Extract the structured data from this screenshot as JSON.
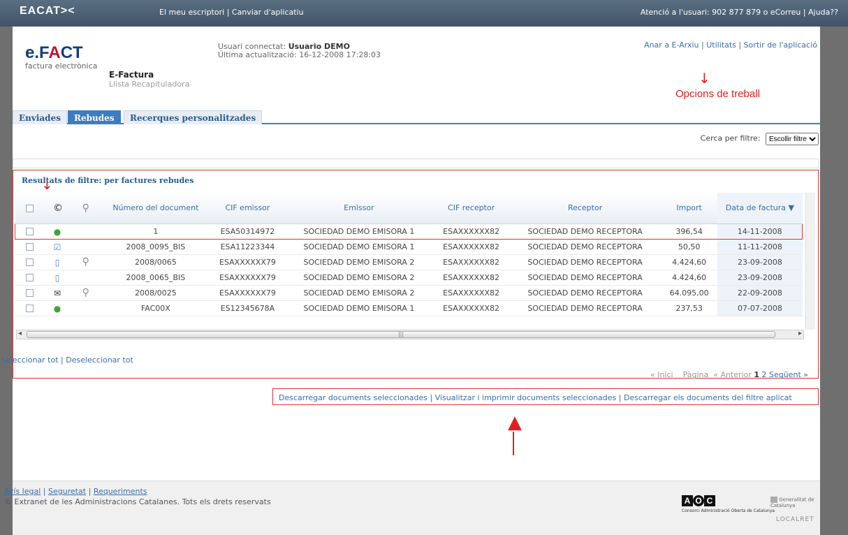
{
  "topbar": {
    "logo": "EACAT><",
    "links": [
      "El meu escriptori",
      "Canviar d'aplicatiu"
    ],
    "support": "Atenció a l'usuari: 902 877 879 o eCorreu | Ajuda??"
  },
  "brand": {
    "efact_pre": "e.F",
    "efact_a": "A",
    "efact_post": "CT",
    "subtitle": "factura electrònica"
  },
  "app": {
    "name": "E-Factura",
    "subtitle": "Llista Recapituladora"
  },
  "user": {
    "label": "Usuari connectat:",
    "name": "Usuario DEMO",
    "last_update": "Última actualització: 16-12-2008 17:28:03"
  },
  "toplinks": [
    "Anar a E-Arxiu",
    "Utilitats",
    "Sortir de l'aplicació"
  ],
  "annotations": {
    "opcions": "Opcions de treball"
  },
  "tabs": [
    "Enviades",
    "Rebudes",
    "Recerques personalitzades"
  ],
  "filter": {
    "label": "Cerca per filtre:",
    "value": "Escollir filtre"
  },
  "results": {
    "title": "Resultats de filtre: per factures rebudes",
    "columns": [
      "",
      "",
      "",
      "Número del document",
      "CIF emissor",
      "Emissor",
      "CIF receptor",
      "Receptor",
      "Import",
      "Data de factura ▼"
    ],
    "rows": [
      {
        "icon": "green",
        "clip": false,
        "num": "1",
        "cif_e": "ESA50314972",
        "emissor": "SOCIEDAD DEMO EMISORA 1",
        "cif_r": "ESAXXXXXX82",
        "receptor": "SOCIEDAD DEMO RECEPTORA",
        "import": "396,54",
        "date": "14-11-2008"
      },
      {
        "icon": "chk",
        "clip": false,
        "num": "2008_0095_BIS",
        "cif_e": "ESA11223344",
        "emissor": "SOCIEDAD DEMO EMISORA 1",
        "cif_r": "ESAXXXXXX82",
        "receptor": "SOCIEDAD DEMO RECEPTORA",
        "import": "50,50",
        "date": "11-11-2008"
      },
      {
        "icon": "doc",
        "clip": true,
        "num": "2008/0065",
        "cif_e": "ESAXXXXXX79",
        "emissor": "SOCIEDAD DEMO EMISORA 2",
        "cif_r": "ESAXXXXXX82",
        "receptor": "SOCIEDAD DEMO RECEPTORA",
        "import": "4.424,60",
        "date": "23-09-2008"
      },
      {
        "icon": "doc",
        "clip": false,
        "num": "2008_0065_BIS",
        "cif_e": "ESAXXXXXX79",
        "emissor": "SOCIEDAD DEMO EMISORA 2",
        "cif_r": "ESAXXXXXX82",
        "receptor": "SOCIEDAD DEMO RECEPTORA",
        "import": "4.424,60",
        "date": "23-09-2008"
      },
      {
        "icon": "mail",
        "clip": true,
        "num": "2008/0025",
        "cif_e": "ESAXXXXXX79",
        "emissor": "SOCIEDAD DEMO EMISORA 2",
        "cif_r": "ESAXXXXXX82",
        "receptor": "SOCIEDAD DEMO RECEPTORA",
        "import": "64.095,00",
        "date": "22-09-2008"
      },
      {
        "icon": "green",
        "clip": false,
        "num": "FAC00X",
        "cif_e": "ES12345678A",
        "emissor": "SOCIEDAD DEMO EMISORA 1",
        "cif_r": "ESAXXXXXX82",
        "receptor": "SOCIEDAD DEMO RECEPTORA",
        "import": "237,53",
        "date": "07-07-2008"
      }
    ]
  },
  "selection": {
    "select_all": "Seleccionar tot",
    "deselect_all": "Deseleccionar tot"
  },
  "pager": {
    "first": "« Inici",
    "page_label": "Pàgina",
    "prev": "« Anterior",
    "current": "1",
    "next_page": "2",
    "next": "Següent »"
  },
  "actions": [
    "Descarregar documents seleccionades",
    "Visualitzar i imprimir documents seleccionades",
    "Descarregar els documents del filtre aplicat"
  ],
  "footer": {
    "links": [
      "Avís legal",
      "Seguretat",
      "Requeriments"
    ],
    "copyright": "© Extranet de les Administracions Catalanes. Tots els drets reservats",
    "aoc_caption": "Consorci Administració Oberta de Catalunya",
    "gen": "Generalitat de Catalunya",
    "localret": "LOCALRET"
  },
  "colors": {
    "accent": "#3e7cc0",
    "annotation": "#e02020",
    "topbar": "#4a5f74"
  }
}
